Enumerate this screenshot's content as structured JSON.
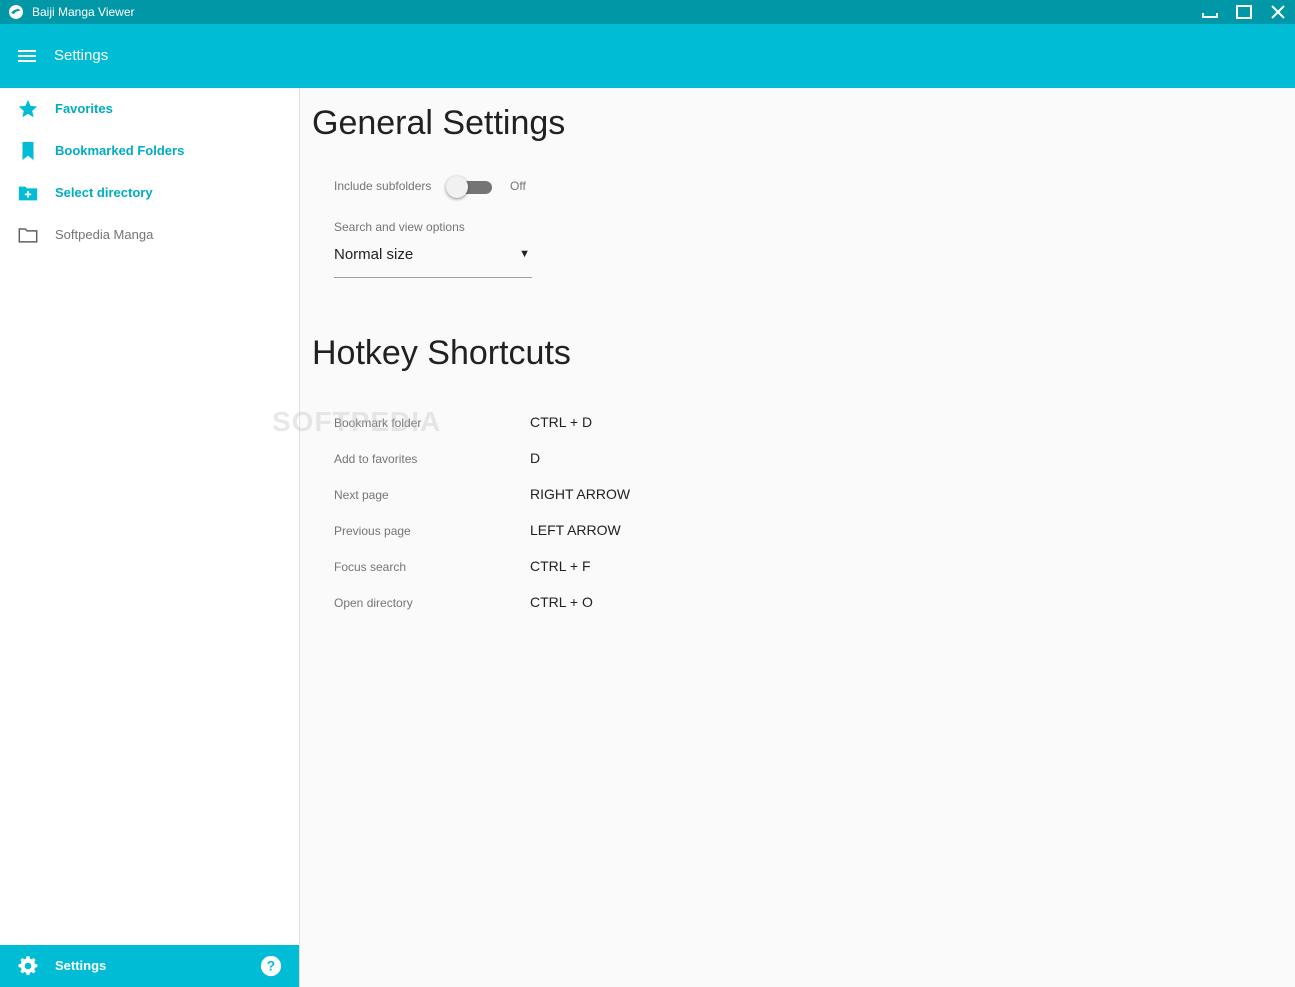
{
  "window": {
    "title": "Baiji Manga Viewer"
  },
  "appbar": {
    "title": "Settings",
    "color": "#00bcd4"
  },
  "sidebar": {
    "items": [
      {
        "label": "Favorites",
        "icon": "star-icon"
      },
      {
        "label": "Bookmarked Folders",
        "icon": "bookmark-icon"
      },
      {
        "label": "Select directory",
        "icon": "folder-add-icon"
      },
      {
        "label": "Softpedia Manga",
        "icon": "folder-icon"
      }
    ],
    "footer": {
      "label": "Settings",
      "icon": "gear-icon",
      "help_icon": "help-icon"
    }
  },
  "general": {
    "title": "General Settings",
    "include_subfolders": {
      "label": "Include subfolders",
      "state": "Off"
    },
    "search_view": {
      "label": "Search and view options",
      "value": "Normal size"
    }
  },
  "hotkeys": {
    "title": "Hotkey Shortcuts",
    "rows": [
      {
        "action": "Bookmark folder",
        "key": "CTRL + D"
      },
      {
        "action": "Add to favorites",
        "key": "D"
      },
      {
        "action": "Next page",
        "key": "RIGHT ARROW"
      },
      {
        "action": "Previous page",
        "key": "LEFT ARROW"
      },
      {
        "action": "Focus search",
        "key": "CTRL + F"
      },
      {
        "action": "Open directory",
        "key": "CTRL + O"
      }
    ]
  },
  "watermark": "SOFTPEDIA"
}
